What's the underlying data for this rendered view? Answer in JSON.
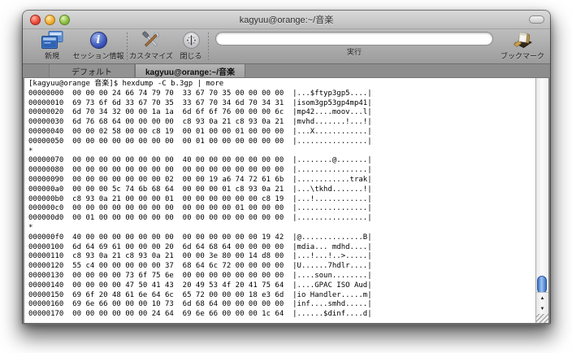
{
  "window": {
    "title": "kagyuu@orange:~/音楽"
  },
  "toolbar": {
    "buttons": [
      {
        "label": "新規",
        "icon": "new-terminal-icon"
      },
      {
        "label": "セッション情報",
        "icon": "info-icon"
      },
      {
        "label": "カスタマイズ",
        "icon": "tools-icon"
      },
      {
        "label": "閉じる",
        "icon": "close-session-icon"
      }
    ],
    "command_field": {
      "value": "",
      "label": "実行"
    },
    "bookmark": {
      "label": "ブックマーク",
      "icon": "bookmark-icon"
    },
    "info_glyph": "i"
  },
  "tabs": [
    {
      "label": "デフォルト",
      "active": false
    },
    {
      "label": "kagyuu@orange:~/音楽",
      "active": true
    }
  ],
  "terminal": {
    "lines": [
      "[kagyuu@orange 音楽]$ hexdump -C b.3gp | more",
      "00000000  00 00 00 24 66 74 79 70  33 67 70 35 00 00 00 00  |...$ftyp3gp5....|",
      "00000010  69 73 6f 6d 33 67 70 35  33 67 70 34 6d 70 34 31  |isom3gp53gp4mp41|",
      "00000020  6d 70 34 32 00 00 1a 1a  6d 6f 6f 76 00 00 00 6c  |mp42....moov...l|",
      "00000030  6d 76 68 64 00 00 00 00  c8 93 0a 21 c8 93 0a 21  |mvhd.......!...!|",
      "00000040  00 00 02 58 00 00 c8 19  00 01 00 00 01 00 00 00  |...X............|",
      "00000050  00 00 00 00 00 00 00 00  00 01 00 00 00 00 00 00  |................|",
      "*",
      "00000070  00 00 00 00 00 00 00 00  40 00 00 00 00 00 00 00  |........@.......|",
      "00000080  00 00 00 00 00 00 00 00  00 00 00 00 00 00 00 00  |................|",
      "00000090  00 00 00 00 00 00 00 02  00 00 19 a6 74 72 61 6b  |............trak|",
      "000000a0  00 00 00 5c 74 6b 68 64  00 00 00 01 c8 93 0a 21  |...\\tkhd.......!|",
      "000000b0  c8 93 0a 21 00 00 00 01  00 00 00 00 00 00 c8 19  |...!............|",
      "000000c0  00 00 00 00 00 00 00 00  00 00 00 00 01 00 00 00  |................|",
      "000000d0  00 01 00 00 00 00 00 00  00 00 00 00 00 00 00 00  |................|",
      "*",
      "000000f0  40 00 00 00 00 00 00 00  00 00 00 00 00 00 19 42  |@..............B|",
      "00000100  6d 64 69 61 00 00 00 20  6d 64 68 64 00 00 00 00  |mdia... mdhd....|",
      "00000110  c8 93 0a 21 c8 93 0a 21  00 00 3e 80 00 14 d8 00  |...!...!..>.....|",
      "00000120  55 c4 00 00 00 00 00 37  68 64 6c 72 00 00 00 00  |U......7hdlr....|",
      "00000130  00 00 00 00 73 6f 75 6e  00 00 00 00 00 00 00 00  |....soun........|",
      "00000140  00 00 00 00 47 50 41 43  20 49 53 4f 20 41 75 64  |....GPAC ISO Aud|",
      "00000150  69 6f 20 48 61 6e 64 6c  65 72 00 00 00 18 e3 6d  |io Handler.....m|",
      "00000160  69 6e 66 00 00 00 10 73  6d 68 64 00 00 00 00 00  |inf....smhd.....|",
      "00000170  00 00 00 00 00 00 24 64  69 6e 66 00 00 00 1c 64  |......$dinf....d|"
    ]
  },
  "scrollbar": {
    "up_glyph": "▲",
    "down_glyph": "▼"
  },
  "colors": {
    "scroll_thumb": "#3a6fc4",
    "titlebar_top": "#dadada",
    "toolbar_bottom": "#9c9c9c",
    "tabbar": "#8d8d8d",
    "terminal_bg": "#ffffff",
    "terminal_text": "#000000",
    "light_red": "#ee4b3a",
    "light_yellow": "#f2af33",
    "light_green": "#8cc043"
  }
}
